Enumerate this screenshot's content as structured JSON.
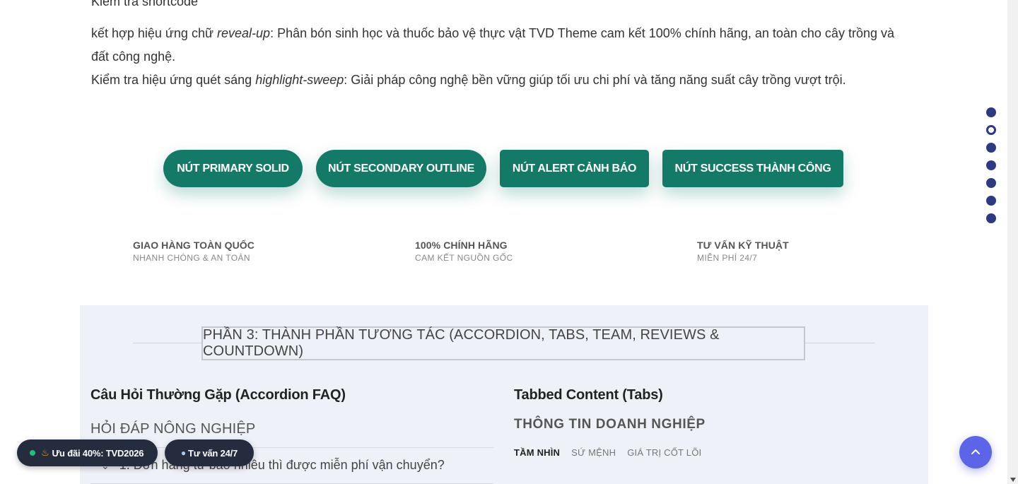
{
  "intro": {
    "top_line": "Kiểm tra shortcode",
    "line1_prefix": "kết hợp hiệu ứng chữ ",
    "line1_em": "reveal-up",
    "line1_suffix": ": Phân bón sinh học và thuốc bảo vệ thực vật TVD Theme cam kết 100% chính hãng, an toàn cho cây trồng và đất công nghệ.",
    "line2_prefix": "Kiểm tra hiệu ứng quét sáng ",
    "line2_em": "highlight-sweep",
    "line2_suffix": ": Giải pháp công nghệ bền vững giúp tối ưu chi phí và tăng năng suất cây trồng vượt trội."
  },
  "buttons": {
    "primary": "NÚT PRIMARY SOLID",
    "secondary": "NÚT SECONDARY OUTLINE",
    "alert": "NÚT ALERT CẢNH BÁO",
    "success": "NÚT SUCCESS THÀNH CÔNG",
    "color": "#147a68"
  },
  "features": [
    {
      "title": "GIAO HÀNG TOÀN QUỐC",
      "subtitle": "NHANH CHÓNG & AN TOÀN"
    },
    {
      "title": "100% CHÍNH HÃNG",
      "subtitle": "CAM KẾT NGUỒN GỐC"
    },
    {
      "title": "TƯ VẤN KỸ THUẬT",
      "subtitle": "MIỄN PHÍ 24/7"
    }
  ],
  "section": {
    "title": "PHẦN 3: THÀNH PHẦN TƯƠNG TÁC (ACCORDION, TABS, TEAM, REVIEWS & COUNTDOWN)",
    "faq": {
      "title": "Câu Hỏi Thường Gặp (Accordion FAQ)",
      "heading": "HỎI ĐÁP NÔNG NGHIỆP",
      "question1": "1. Đơn hàng từ bao nhiêu thì được miễn phí vận chuyển?"
    },
    "tabs": {
      "title": "Tabbed Content (Tabs)",
      "heading": "THÔNG TIN DOANH NGHIỆP",
      "items": [
        "TẦM NHÌN",
        "SỨ MỆNH",
        "GIÁ TRỊ CỐT LÕI"
      ],
      "active": 0
    }
  },
  "side_nav": {
    "count": 7,
    "active": 1,
    "color": "#2c3a84"
  },
  "floating": {
    "promo": "Ưu đãi 40%: TVD2026",
    "chat": "Tư vấn 24/7"
  },
  "icons": {
    "promo": "fire-icon",
    "chat": "chat-bubble-icon",
    "back_to_top": "chevron-up-icon"
  }
}
